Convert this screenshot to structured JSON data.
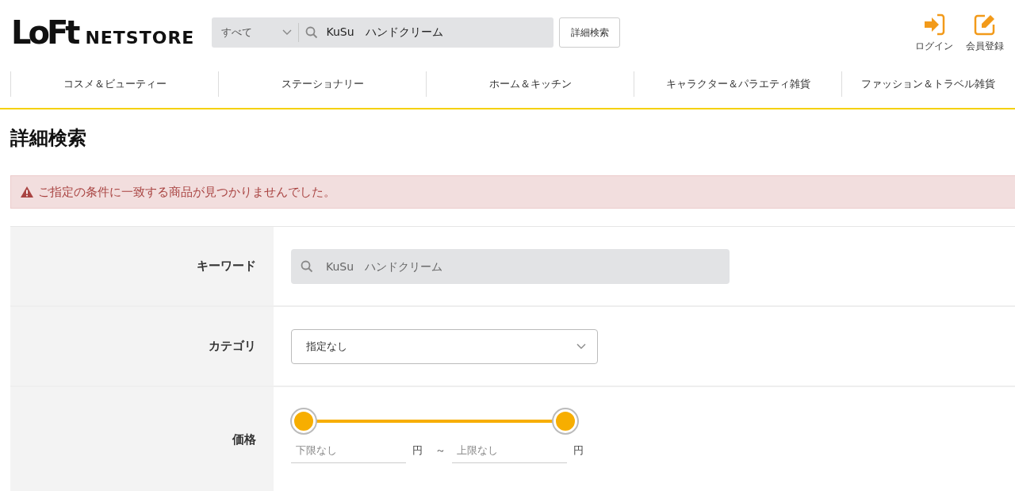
{
  "header": {
    "logo": {
      "mark": "LoFt",
      "text": "NETSTORE"
    },
    "search": {
      "scope": "すべて",
      "value": "KuSu　ハンドクリーム"
    },
    "advanced_button": "詳細検索",
    "actions": [
      {
        "kind": "login",
        "label": "ログイン"
      },
      {
        "kind": "register",
        "label": "会員登録"
      }
    ]
  },
  "nav": [
    "コスメ＆ビューティー",
    "ステーショナリー",
    "ホーム＆キッチン",
    "キャラクター＆パラエティ雑貨",
    "ファッション＆トラベル雑貨"
  ],
  "page_title": "詳細検索",
  "alert": "ご指定の条件に一致する商品が見つかりませんでした。",
  "form": [
    {
      "kind": "keyword",
      "label": "キーワード",
      "placeholder": "KuSu　ハンドクリーム"
    },
    {
      "kind": "select",
      "label": "カテゴリ",
      "value": "指定なし"
    },
    {
      "kind": "price",
      "label": "価格",
      "thumbs": [
        {
          "level": 0
        },
        {
          "level": 1
        }
      ],
      "min_placeholder": "下限なし",
      "max_placeholder": "上限なし",
      "unit_min": "円",
      "separator": "～",
      "unit_max": "円"
    }
  ]
}
